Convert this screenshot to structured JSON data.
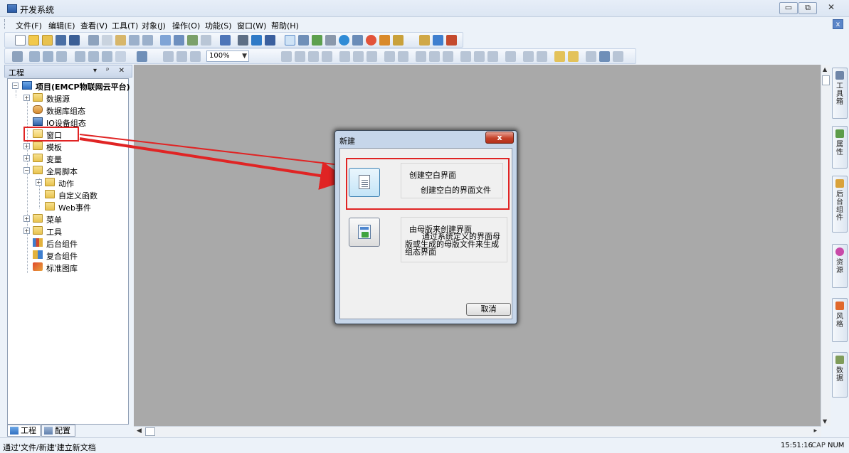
{
  "window": {
    "title": "开发系统",
    "minimize_label": "▭",
    "restore_label": "⧉",
    "close_label": "✕"
  },
  "menubar": {
    "items": [
      "文件(F)",
      "编辑(E)",
      "查看(V)",
      "工具(T)",
      "对象(J)",
      "操作(O)",
      "功能(S)",
      "窗口(W)",
      "帮助(H)"
    ],
    "mdi_close": "x"
  },
  "toolbar": {
    "zoom_value": "100%"
  },
  "project_panel": {
    "title": "工程",
    "controls": "▾ ᵖ ✕",
    "tree": [
      {
        "label": "项目(EMCP物联网云平台)",
        "bold": true
      },
      {
        "label": "数据源"
      },
      {
        "label": "数据库组态"
      },
      {
        "label": "IO设备组态"
      },
      {
        "label": "窗口"
      },
      {
        "label": "模板"
      },
      {
        "label": "变量"
      },
      {
        "label": "全局脚本"
      },
      {
        "label": "动作"
      },
      {
        "label": "自定义函数"
      },
      {
        "label": "Web事件"
      },
      {
        "label": "菜单"
      },
      {
        "label": "工具"
      },
      {
        "label": "后台组件"
      },
      {
        "label": "复合组件"
      },
      {
        "label": "标准图库"
      }
    ],
    "tabs": [
      "工程",
      "配置"
    ]
  },
  "right_dock": {
    "tabs": [
      "工具箱",
      "属性",
      "后台组件",
      "资源",
      "风格",
      "数据"
    ]
  },
  "dialog": {
    "title": "新建",
    "close_label": "x",
    "option_blank_title": "创建空白界面",
    "option_blank_desc": "创建空白的界面文件",
    "option_template_title": "由母版来创建界面",
    "option_template_desc": "通过系统定义的界面母版或生成的母版文件来生成组态界面",
    "cancel_label": "取消"
  },
  "statusbar": {
    "message": "通过'文件/新建'建立新文档",
    "time": "15:51:16",
    "caps": "CAP",
    "num": "NUM"
  },
  "colors": {
    "highlight_red": "#e02424",
    "workspace_gray": "#a9a9a9",
    "dialog_frame": "#c6d6ea"
  }
}
